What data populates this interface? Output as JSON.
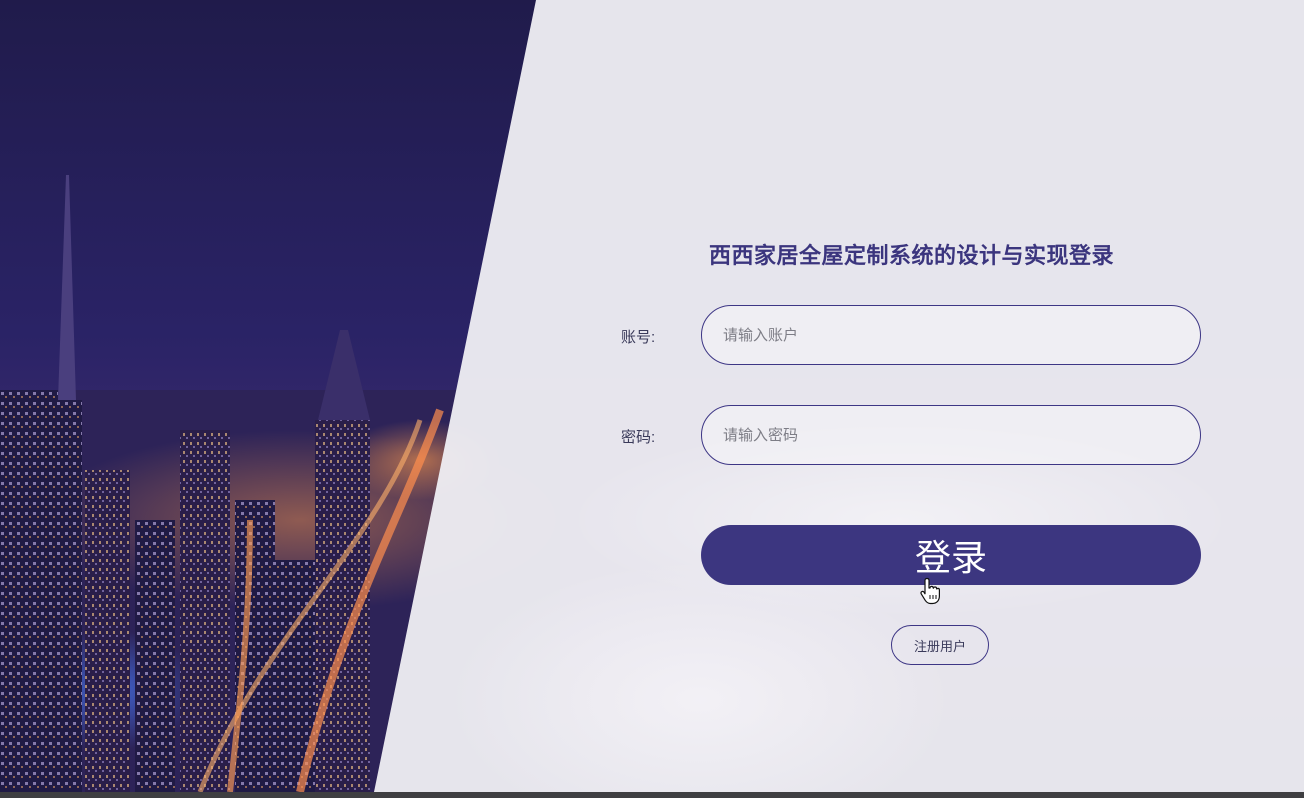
{
  "login": {
    "title": "西西家居全屋定制系统的设计与实现登录",
    "account_label": "账号:",
    "account_placeholder": "请输入账户",
    "account_value": "",
    "password_label": "密码:",
    "password_placeholder": "请输入密码",
    "password_value": "",
    "login_button": "登录",
    "register_button": "注册用户"
  },
  "colors": {
    "accent": "#3c3680",
    "title": "#3b357e",
    "panel": "#edecf1",
    "night_sky": "#241f52"
  },
  "icons": {
    "cursor": "hand-pointer-cursor-icon"
  }
}
